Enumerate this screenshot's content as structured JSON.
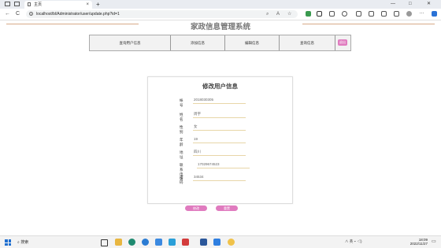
{
  "browser": {
    "tab_title": "主页",
    "tab_close": "×",
    "new_tab": "+",
    "url": "localhost/bl/Administrator/user/update.php?id=1",
    "nav_back": "←",
    "nav_forward": "→",
    "nav_reload": "C",
    "window_min": "—",
    "window_max": "□",
    "window_close": "✕"
  },
  "page": {
    "system_title": "家政信息管理系统",
    "menu": [
      "查询用户信息",
      "添加信息",
      "编辑信息",
      "查询信息"
    ],
    "logout": "退出"
  },
  "form": {
    "title": "修改用户信息",
    "fields": [
      {
        "label": "帐　号",
        "value": "2018030305"
      },
      {
        "label": "姓　名",
        "value": "周宇"
      },
      {
        "label": "性　别",
        "value": "女"
      },
      {
        "label": "年　龄",
        "value": "19"
      },
      {
        "label": "地　址",
        "value": "四川"
      },
      {
        "label": "联系电话",
        "value": "17029674523"
      },
      {
        "label": "密码",
        "value": "34534"
      }
    ],
    "submit": "修改",
    "reset": "重置"
  },
  "taskbar": {
    "search_placeholder": "搜索",
    "clock_time": "18:09",
    "clock_date": "2022/11/27",
    "tray_text": "∧ 英 ⌁ ◁)"
  },
  "colors": {
    "accent": "#e07bbf",
    "divider": "#d7aa88"
  }
}
